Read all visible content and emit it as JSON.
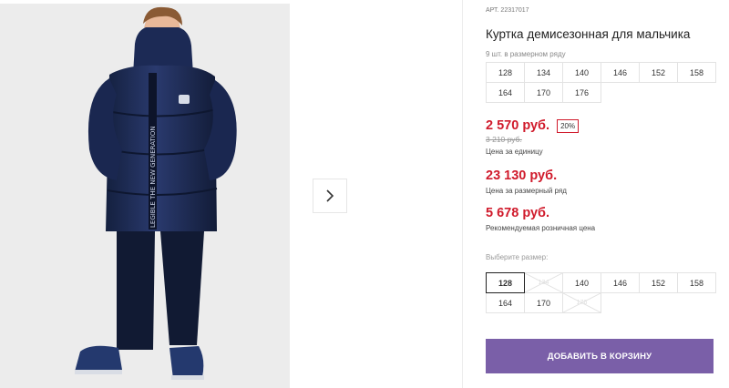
{
  "product": {
    "art_label": "АРТ.",
    "art_number": "22317017",
    "title": "Куртка демисезонная для мальчика"
  },
  "size_row": {
    "caption": "9 шт. в размерном ряду",
    "sizes": [
      "128",
      "134",
      "140",
      "146",
      "152",
      "158",
      "164",
      "170",
      "176"
    ]
  },
  "prices": {
    "unit_price": "2 570 руб.",
    "discount_badge": "20%",
    "old_price": "3 210 руб.",
    "unit_label": "Цена за единицу",
    "row_price": "23 130 руб.",
    "row_label": "Цена за размерный ряд",
    "rrp_price": "5 678 руб.",
    "rrp_label": "Рекомендуемая розничная цена"
  },
  "size_picker": {
    "caption": "Выберите размер:",
    "options": [
      {
        "label": "128",
        "state": "selected"
      },
      {
        "label": "134",
        "state": "unavailable"
      },
      {
        "label": "140",
        "state": "available"
      },
      {
        "label": "146",
        "state": "available"
      },
      {
        "label": "152",
        "state": "available"
      },
      {
        "label": "158",
        "state": "available"
      },
      {
        "label": "164",
        "state": "available"
      },
      {
        "label": "170",
        "state": "available"
      },
      {
        "label": "176",
        "state": "unavailable"
      }
    ]
  },
  "cart_button": "ДОБАВИТЬ В КОРЗИНУ",
  "gallery": {
    "next_icon": "chevron-right-icon",
    "jacket_print": "LEGIBLE THE NEW GENERATION",
    "logo": "SC"
  },
  "colors": {
    "price_red": "#d01a2b",
    "button_purple": "#7a5fa8",
    "jacket_navy": "#1c2a55"
  }
}
